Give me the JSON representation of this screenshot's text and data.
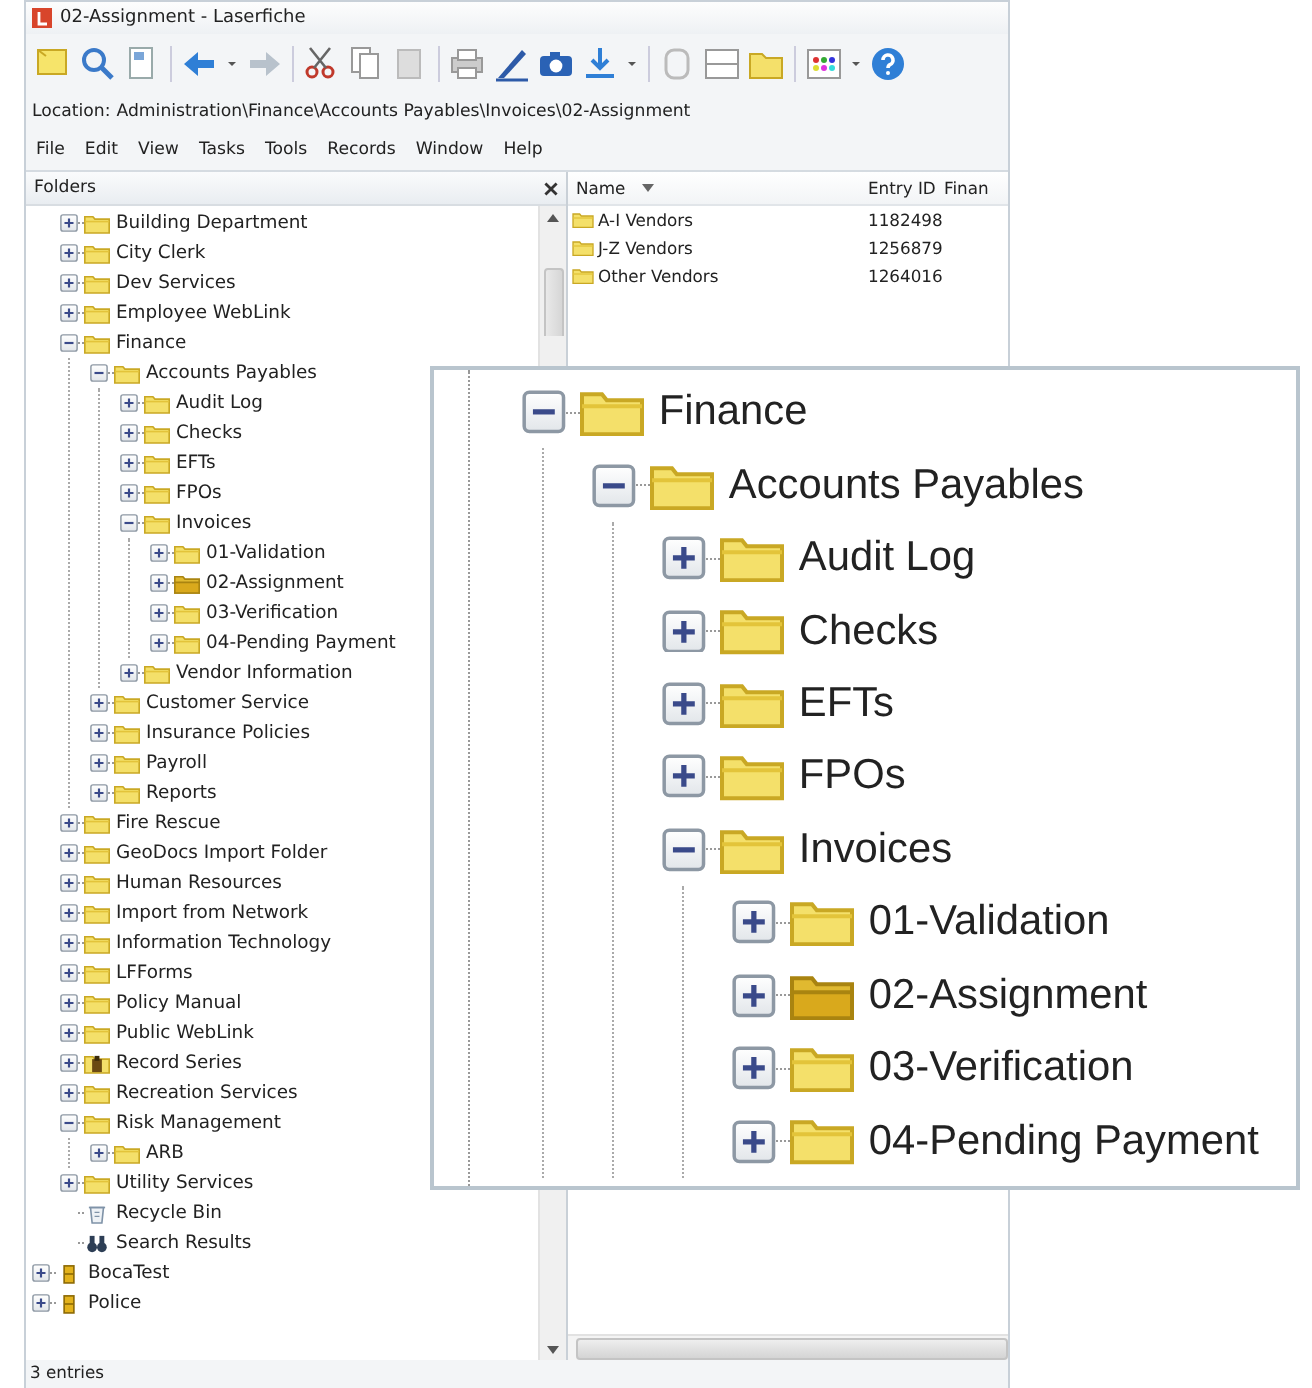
{
  "window": {
    "title": "02-Assignment - Laserfiche"
  },
  "location": {
    "label": "Location:",
    "path": "Administration\\Finance\\Accounts Payables\\Invoices\\02-Assignment"
  },
  "menu": [
    "File",
    "Edit",
    "View",
    "Tasks",
    "Tools",
    "Records",
    "Window",
    "Help"
  ],
  "folders": {
    "title": "Folders",
    "scrolled_branch": [
      {
        "label": "Building Department",
        "kind": "folder",
        "expanded": false
      },
      {
        "label": "City Clerk",
        "kind": "folder",
        "expanded": false
      },
      {
        "label": "Dev Services",
        "kind": "folder",
        "expanded": false
      },
      {
        "label": "Employee WebLink",
        "kind": "folder",
        "expanded": false
      },
      {
        "label": "Finance",
        "kind": "folder",
        "expanded": true,
        "children": [
          {
            "label": "Accounts Payables",
            "kind": "folder",
            "expanded": true,
            "children": [
              {
                "label": "Audit Log",
                "kind": "folder",
                "expanded": false
              },
              {
                "label": "Checks",
                "kind": "folder",
                "expanded": false
              },
              {
                "label": "EFTs",
                "kind": "folder",
                "expanded": false
              },
              {
                "label": "FPOs",
                "kind": "folder",
                "expanded": false
              },
              {
                "label": "Invoices",
                "kind": "folder",
                "expanded": true,
                "children": [
                  {
                    "label": "01-Validation",
                    "kind": "folder",
                    "expanded": false
                  },
                  {
                    "label": "02-Assignment",
                    "kind": "open-folder",
                    "expanded": false
                  },
                  {
                    "label": "03-Verification",
                    "kind": "folder",
                    "expanded": false
                  },
                  {
                    "label": "04-Pending Payment",
                    "kind": "folder",
                    "expanded": false
                  }
                ]
              },
              {
                "label": "Vendor Information",
                "kind": "folder",
                "expanded": false
              }
            ]
          },
          {
            "label": "Customer Service",
            "kind": "folder",
            "expanded": false
          },
          {
            "label": "Insurance Policies",
            "kind": "folder",
            "expanded": false
          },
          {
            "label": "Payroll",
            "kind": "folder",
            "expanded": false
          },
          {
            "label": "Reports",
            "kind": "folder",
            "expanded": false
          }
        ]
      },
      {
        "label": "Fire Rescue",
        "kind": "folder",
        "expanded": false
      },
      {
        "label": "GeoDocs Import Folder",
        "kind": "folder",
        "expanded": false
      },
      {
        "label": "Human Resources",
        "kind": "folder",
        "expanded": false
      },
      {
        "label": "Import from Network",
        "kind": "folder",
        "expanded": false
      },
      {
        "label": "Information Technology",
        "kind": "folder",
        "expanded": false
      },
      {
        "label": "LFForms",
        "kind": "folder",
        "expanded": false
      },
      {
        "label": "Policy Manual",
        "kind": "folder",
        "expanded": false
      },
      {
        "label": "Public WebLink",
        "kind": "folder",
        "expanded": false
      },
      {
        "label": "Record Series",
        "kind": "record-series",
        "expanded": false
      },
      {
        "label": "Recreation Services",
        "kind": "folder",
        "expanded": false
      },
      {
        "label": "Risk Management",
        "kind": "folder",
        "expanded": true,
        "children": [
          {
            "label": "ARB",
            "kind": "folder",
            "expanded": false
          }
        ]
      },
      {
        "label": "Utility Services",
        "kind": "folder",
        "expanded": false
      },
      {
        "label": "Recycle Bin",
        "kind": "recycle-bin"
      },
      {
        "label": "Search Results",
        "kind": "search-results"
      }
    ],
    "items": [
      {
        "label": "BocaTest",
        "kind": "repository",
        "expanded": false
      },
      {
        "label": "Police",
        "kind": "repository",
        "expanded": false
      }
    ]
  },
  "contents": {
    "columns": [
      "Name",
      "Entry ID",
      "Finan"
    ],
    "rows": [
      {
        "name": "A-I Vendors",
        "entry_id": "1182498"
      },
      {
        "name": "J-Z Vendors",
        "entry_id": "1256879"
      },
      {
        "name": "Other Vendors",
        "entry_id": "1264016"
      }
    ]
  },
  "status_bar": "3 entries",
  "zoom_callout": {
    "items": [
      {
        "label": "Finance",
        "kind": "folder",
        "expanded": true,
        "children": [
          {
            "label": "Accounts Payables",
            "kind": "folder",
            "expanded": true,
            "children": [
              {
                "label": "Audit Log",
                "kind": "folder",
                "expanded": false
              },
              {
                "label": "Checks",
                "kind": "folder",
                "expanded": false
              },
              {
                "label": "EFTs",
                "kind": "folder",
                "expanded": false
              },
              {
                "label": "FPOs",
                "kind": "folder",
                "expanded": false
              },
              {
                "label": "Invoices",
                "kind": "folder",
                "expanded": true,
                "children": [
                  {
                    "label": "01-Validation",
                    "kind": "folder",
                    "expanded": false
                  },
                  {
                    "label": "02-Assignment",
                    "kind": "open-folder",
                    "expanded": false
                  },
                  {
                    "label": "03-Verification",
                    "kind": "folder",
                    "expanded": false
                  },
                  {
                    "label": "04-Pending Payment",
                    "kind": "folder",
                    "expanded": false
                  }
                ]
              }
            ]
          }
        ]
      }
    ]
  }
}
